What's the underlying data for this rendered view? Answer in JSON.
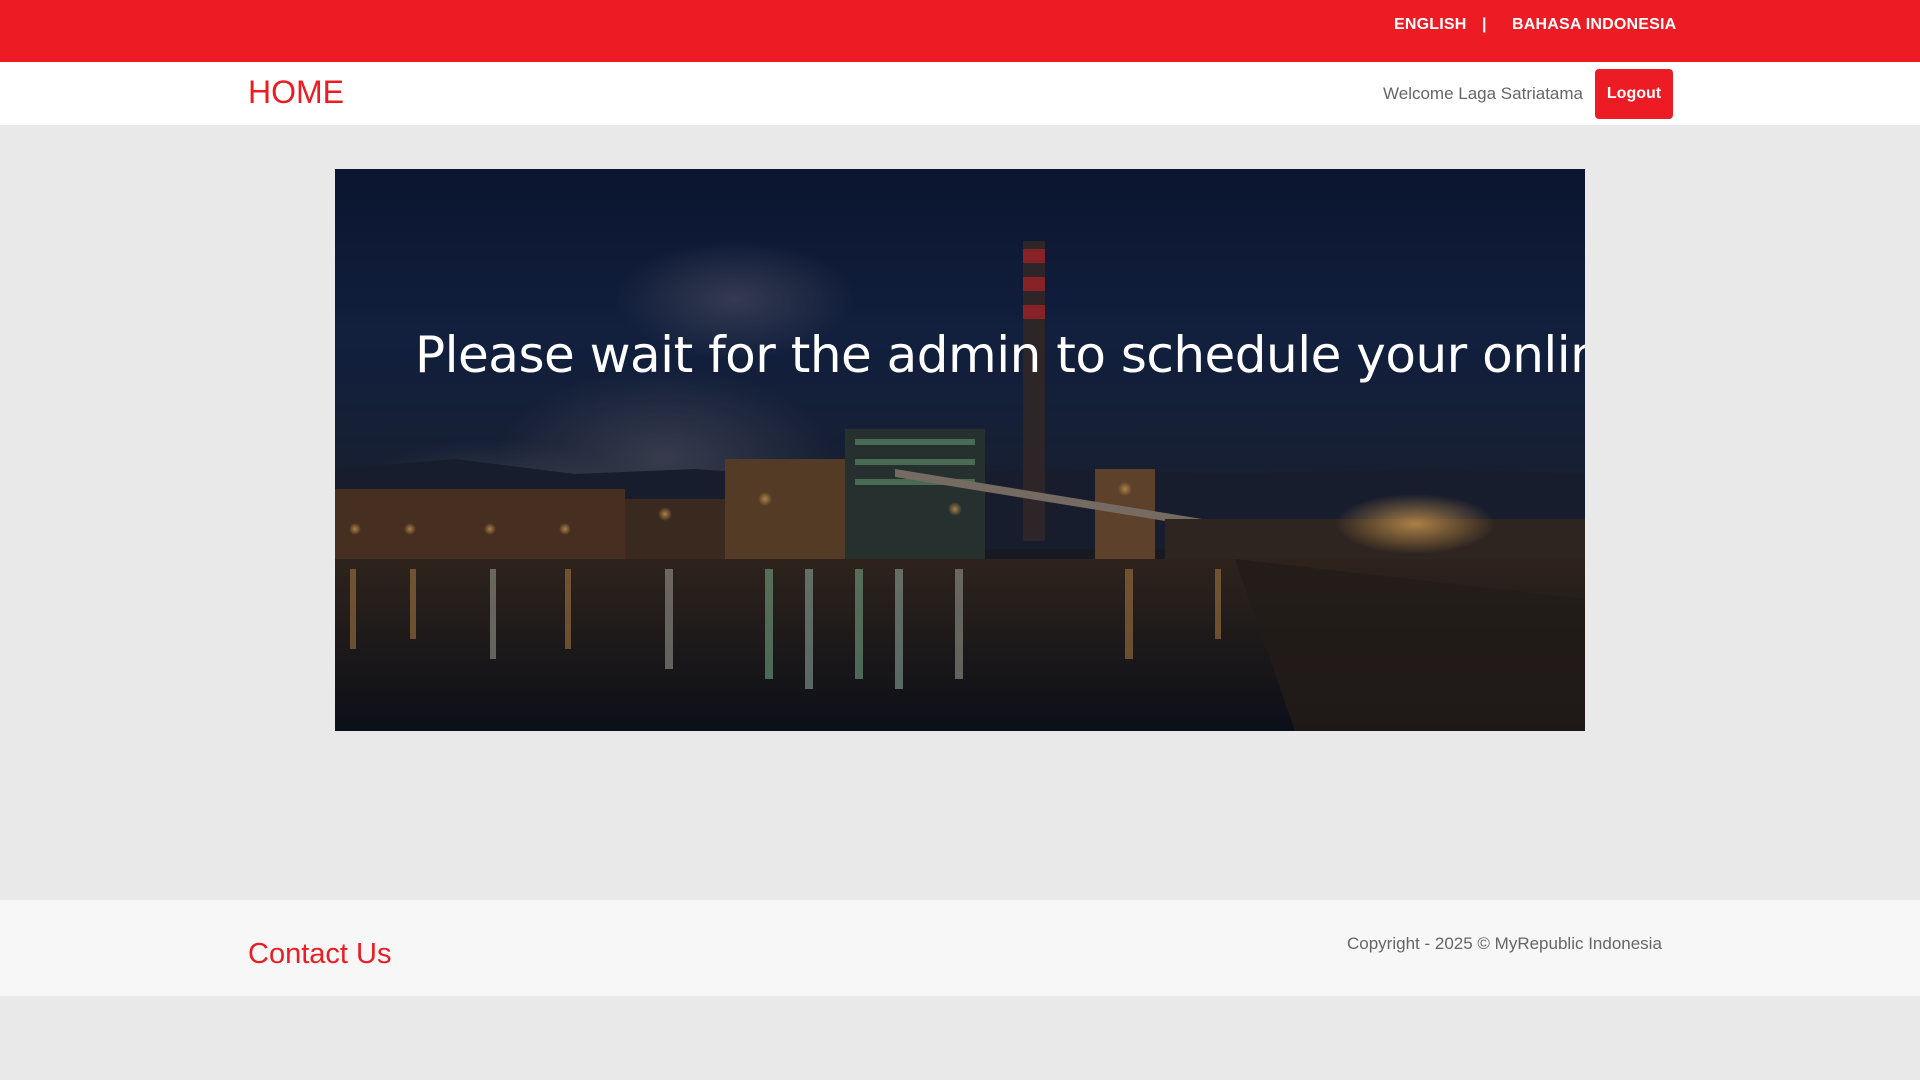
{
  "language_bar": {
    "english": "ENGLISH",
    "separator": "|",
    "bahasa": "BAHASA INDONESIA"
  },
  "navbar": {
    "home": "HOME",
    "welcome": "Welcome Laga Satriatama",
    "logout": "Logout"
  },
  "hero": {
    "message": "Please wait for the admin to schedule your online test."
  },
  "footer": {
    "contact": "Contact Us",
    "copyright": "Copyright - 2025 © MyRepublic Indonesia"
  },
  "colors": {
    "brand_red": "#ed1c24",
    "page_bg": "#e9e9e9",
    "footer_bg": "#f7f7f7",
    "muted_text": "#666666"
  }
}
